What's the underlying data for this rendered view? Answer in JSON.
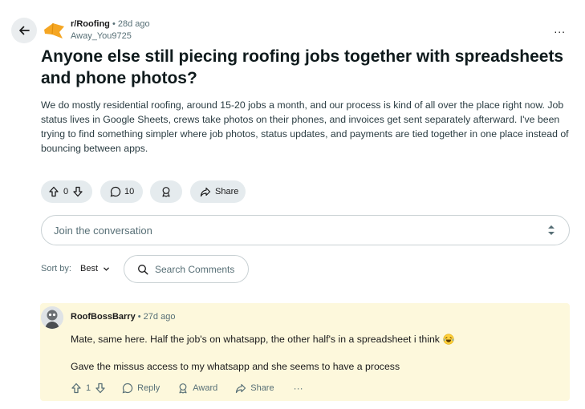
{
  "post": {
    "subreddit": "r/Roofing",
    "age": "28d ago",
    "author": "Away_You9725",
    "title": "Anyone else still piecing roofing jobs together with spreadsheets and phone photos?",
    "body": "We do mostly residential roofing, around 15-20 jobs a month, and our process is kind of all over the place right now. Job status lives in Google Sheets, crews take photos on their phones, and invoices get sent separately afterward. I've been trying to find something simpler where job photos, status updates, and payments are tied together in one place instead of bouncing between apps.",
    "votes": "0",
    "comments": "10",
    "share_label": "Share",
    "more_label": "..."
  },
  "composer": {
    "placeholder": "Join the conversation"
  },
  "sort": {
    "label": "Sort by:",
    "value": "Best",
    "search_placeholder": "Search Comments"
  },
  "comment": {
    "author": "RoofBossBarry",
    "age": "27d ago",
    "line1": "Mate, same here. Half the job's on whatsapp, the other half's in a spreadsheet i think",
    "line2": "Gave the missus access to my whatsapp and she seems to have a process",
    "votes": "1",
    "reply_label": "Reply",
    "award_label": "Award",
    "share_label": "Share",
    "more_label": "···"
  },
  "colors": {
    "accent": "#f5a623",
    "pill": "#e5ebee",
    "highlight": "#fdf8dc"
  }
}
